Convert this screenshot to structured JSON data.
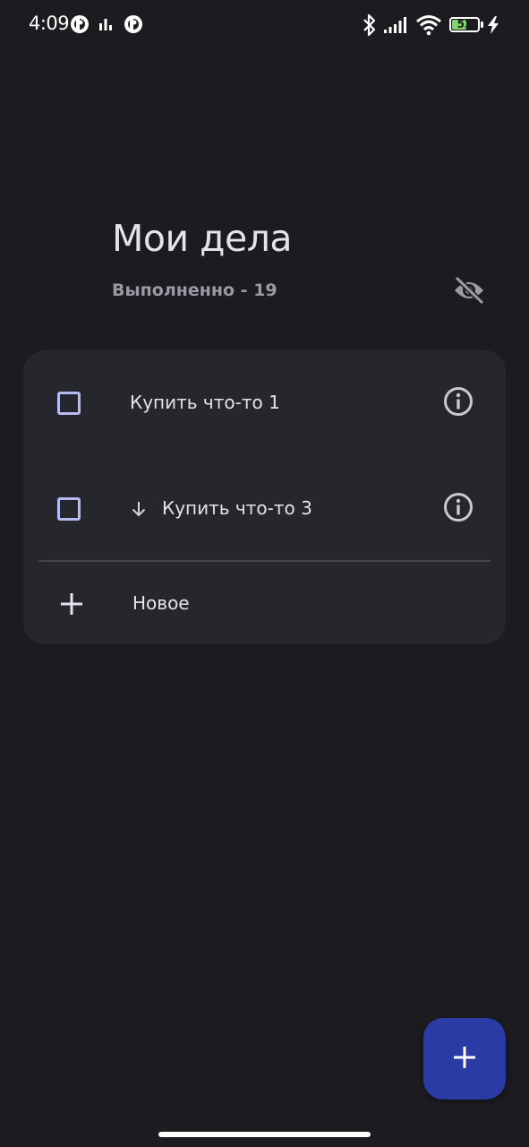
{
  "status_bar": {
    "time": "4:09",
    "battery_level": "53",
    "icons": [
      "app-notification-icon",
      "bar-chart-icon",
      "app-notification-icon",
      "bluetooth-icon",
      "cellular-signal-icon",
      "wifi-icon",
      "battery-icon",
      "charging-bolt-icon"
    ]
  },
  "header": {
    "title": "Мои дела",
    "done_label": "Выполненно - 19",
    "visibility_icon": "eye-off-icon"
  },
  "todos": [
    {
      "text": "Купить что-то 1",
      "priority": "",
      "checked": false,
      "info_icon": "info-icon"
    },
    {
      "text": "Купить что-то 3",
      "priority": "low",
      "priority_icon": "arrow-down-icon",
      "checked": false,
      "info_icon": "info-icon"
    }
  ],
  "new_item": {
    "label": "Новое",
    "icon": "plus-icon"
  },
  "fab": {
    "icon": "plus-icon"
  },
  "colors": {
    "background": "#1c1b20",
    "card": "#26262d",
    "checkbox_border": "#b5baf2",
    "fab": "#2b3ba5",
    "text_primary": "#e4e2ea",
    "text_secondary": "#9b99a3"
  }
}
